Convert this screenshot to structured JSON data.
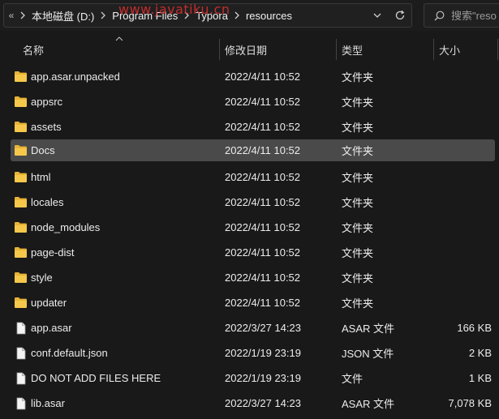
{
  "address": {
    "breadcrumbs": [
      "本地磁盘 (D:)",
      "Program Files",
      "Typora",
      "resources"
    ],
    "overflow_chevron": "«"
  },
  "search": {
    "placeholder": "搜索\"reso"
  },
  "columns": {
    "name": "名称",
    "date": "修改日期",
    "type": "类型",
    "size": "大小"
  },
  "watermark": "www.javatiku.cn",
  "colors": {
    "folder": "#f5c84c",
    "selected_row": "#4a4a4a",
    "watermark": "#e0302f"
  },
  "selected_index": 3,
  "files": [
    {
      "name": "app.asar.unpacked",
      "date": "2022/4/11 10:52",
      "type": "文件夹",
      "size": "",
      "icon": "folder-icon"
    },
    {
      "name": "appsrc",
      "date": "2022/4/11 10:52",
      "type": "文件夹",
      "size": "",
      "icon": "folder-icon"
    },
    {
      "name": "assets",
      "date": "2022/4/11 10:52",
      "type": "文件夹",
      "size": "",
      "icon": "folder-icon"
    },
    {
      "name": "Docs",
      "date": "2022/4/11 10:52",
      "type": "文件夹",
      "size": "",
      "icon": "folder-icon"
    },
    {
      "name": "html",
      "date": "2022/4/11 10:52",
      "type": "文件夹",
      "size": "",
      "icon": "folder-icon"
    },
    {
      "name": "locales",
      "date": "2022/4/11 10:52",
      "type": "文件夹",
      "size": "",
      "icon": "folder-icon"
    },
    {
      "name": "node_modules",
      "date": "2022/4/11 10:52",
      "type": "文件夹",
      "size": "",
      "icon": "folder-icon"
    },
    {
      "name": "page-dist",
      "date": "2022/4/11 10:52",
      "type": "文件夹",
      "size": "",
      "icon": "folder-icon"
    },
    {
      "name": "style",
      "date": "2022/4/11 10:52",
      "type": "文件夹",
      "size": "",
      "icon": "folder-icon"
    },
    {
      "name": "updater",
      "date": "2022/4/11 10:52",
      "type": "文件夹",
      "size": "",
      "icon": "folder-icon"
    },
    {
      "name": "app.asar",
      "date": "2022/3/27 14:23",
      "type": "ASAR 文件",
      "size": "166 KB",
      "icon": "file-icon"
    },
    {
      "name": "conf.default.json",
      "date": "2022/1/19 23:19",
      "type": "JSON 文件",
      "size": "2 KB",
      "icon": "file-icon"
    },
    {
      "name": "DO NOT ADD FILES HERE",
      "date": "2022/1/19 23:19",
      "type": "文件",
      "size": "1 KB",
      "icon": "file-icon"
    },
    {
      "name": "lib.asar",
      "date": "2022/3/27 14:23",
      "type": "ASAR 文件",
      "size": "7,078 KB",
      "icon": "file-icon"
    }
  ]
}
